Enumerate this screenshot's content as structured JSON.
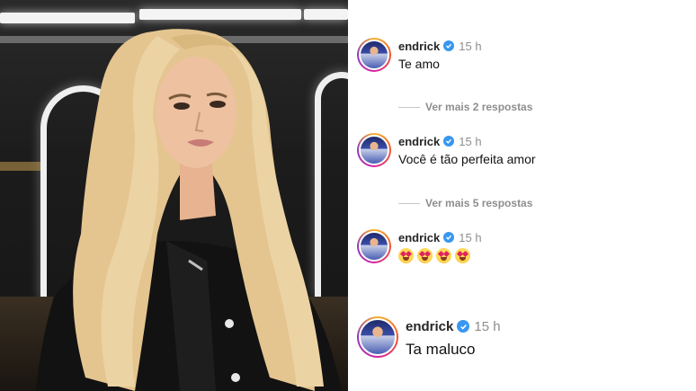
{
  "photo": {
    "alt": "Woman with long blonde hair in black leather jacket"
  },
  "comments": [
    {
      "username": "endrick",
      "time": "15 h",
      "text": "Te amo",
      "verified": true
    },
    {
      "username": "endrick",
      "time": "15 h",
      "text": "Você é tão perfeita amor",
      "verified": true
    },
    {
      "username": "endrick",
      "time": "15 h",
      "emojis": [
        "smiling-face-with-heart-eyes",
        "smiling-face-with-heart-eyes",
        "smiling-face-with-heart-eyes",
        "smiling-face-with-heart-eyes"
      ],
      "verified": true
    },
    {
      "username": "endrick",
      "time": "15 h",
      "text": "Ta maluco",
      "verified": true
    }
  ],
  "replies": [
    {
      "label": "Ver mais 2 respostas"
    },
    {
      "label": "Ver mais 5 respostas"
    }
  ],
  "colors": {
    "verified": "#3897f0",
    "muted": "#8e8e8e",
    "text": "#262626",
    "hair": "#e9cf9c"
  }
}
